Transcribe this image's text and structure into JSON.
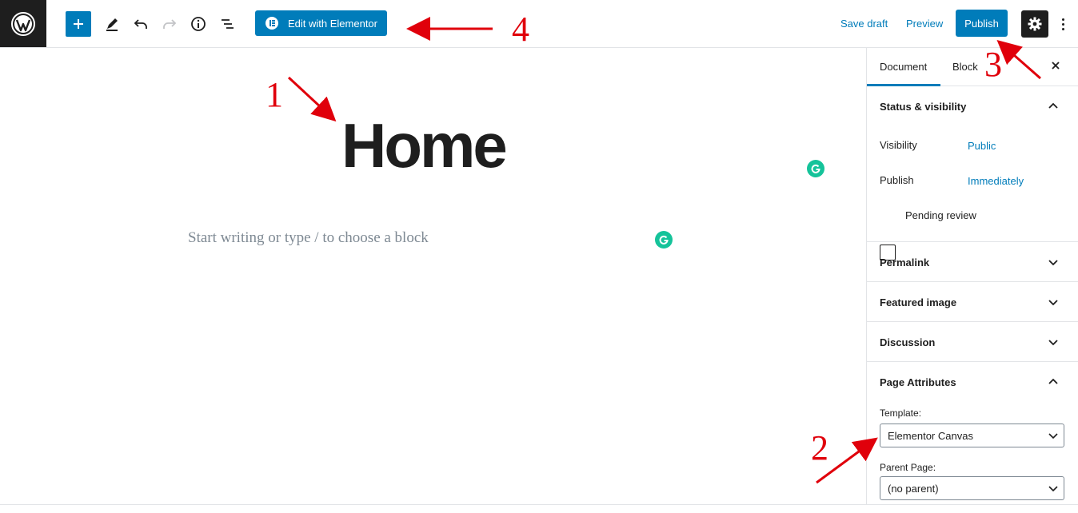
{
  "toolbar": {
    "elementor_label": "Edit with Elementor",
    "save_draft_label": "Save draft",
    "preview_label": "Preview",
    "publish_label": "Publish"
  },
  "editor": {
    "title": "Home",
    "placeholder": "Start writing or type / to choose a block"
  },
  "sidebar": {
    "tabs": [
      "Document",
      "Block"
    ],
    "status_visibility": {
      "title": "Status & visibility",
      "visibility_label": "Visibility",
      "visibility_value": "Public",
      "publish_label": "Publish",
      "publish_value": "Immediately",
      "pending_label": "Pending review"
    },
    "permalink": "Permalink",
    "featured_image": "Featured image",
    "discussion": "Discussion",
    "page_attributes": {
      "title": "Page Attributes",
      "template_label": "Template:",
      "template_value": "Elementor Canvas",
      "parent_label": "Parent Page:",
      "parent_value": "(no parent)"
    }
  },
  "annotations": [
    "1",
    "2",
    "3",
    "4"
  ],
  "colors": {
    "accent": "#007cba",
    "annotation": "#e0000b",
    "grammarly": "#15c39a"
  }
}
